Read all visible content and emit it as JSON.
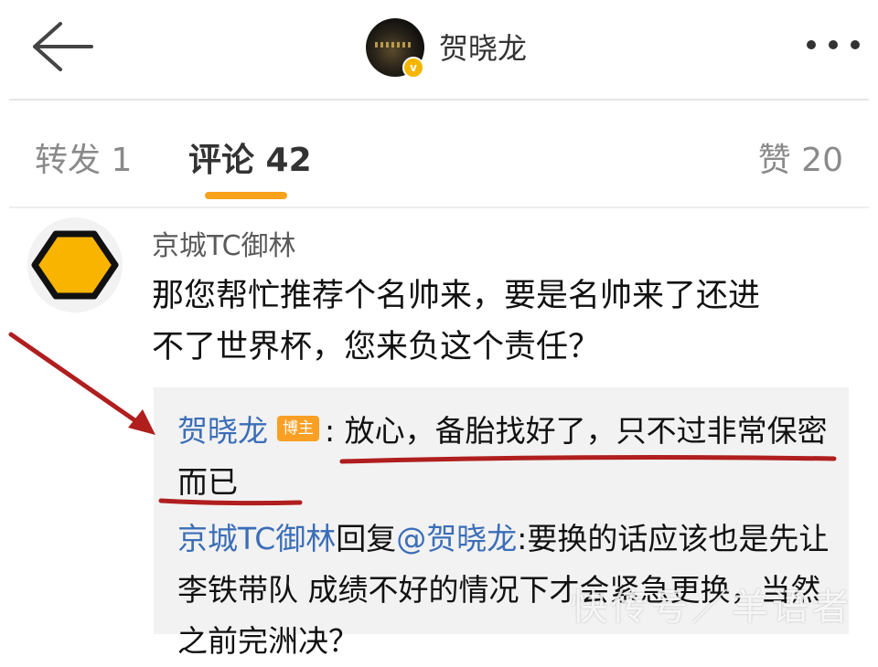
{
  "header": {
    "title": "贺晓龙",
    "verified_badge": "v",
    "back_icon": "arrow-left-icon",
    "more_icon": "more-horizontal-icon"
  },
  "tabs": [
    {
      "label": "转发 1"
    },
    {
      "label": "评论 42",
      "active": true
    },
    {
      "label": "赞 20"
    }
  ],
  "colors": {
    "accent": "#f7a21a",
    "link": "#3b6eb8",
    "annotation_red": "#b01e1e",
    "badge_orange": "#f9a024",
    "avatar_yellow": "#f9b400"
  },
  "comment": {
    "author": "京城TC御林",
    "text_line1": "那您帮忙推荐个名帅来，要是名帅来了还进",
    "text_line2": "不了世界杯，您来负这个责任？",
    "avatar_icon": "hexagon-icon"
  },
  "replies": [
    {
      "author": "贺晓龙",
      "badge": "博主",
      "text": ": 放心，备胎找好了，只不过非常保密而已"
    },
    {
      "author": "京城TC御林",
      "verb": "回复",
      "mention": "@贺晓龙",
      "text": ":要换的话应该也是先让李铁带队 成绩不好的情况下才会紧急更换，当然之前完洲决？"
    }
  ],
  "watermark": "快传号／羊语者"
}
